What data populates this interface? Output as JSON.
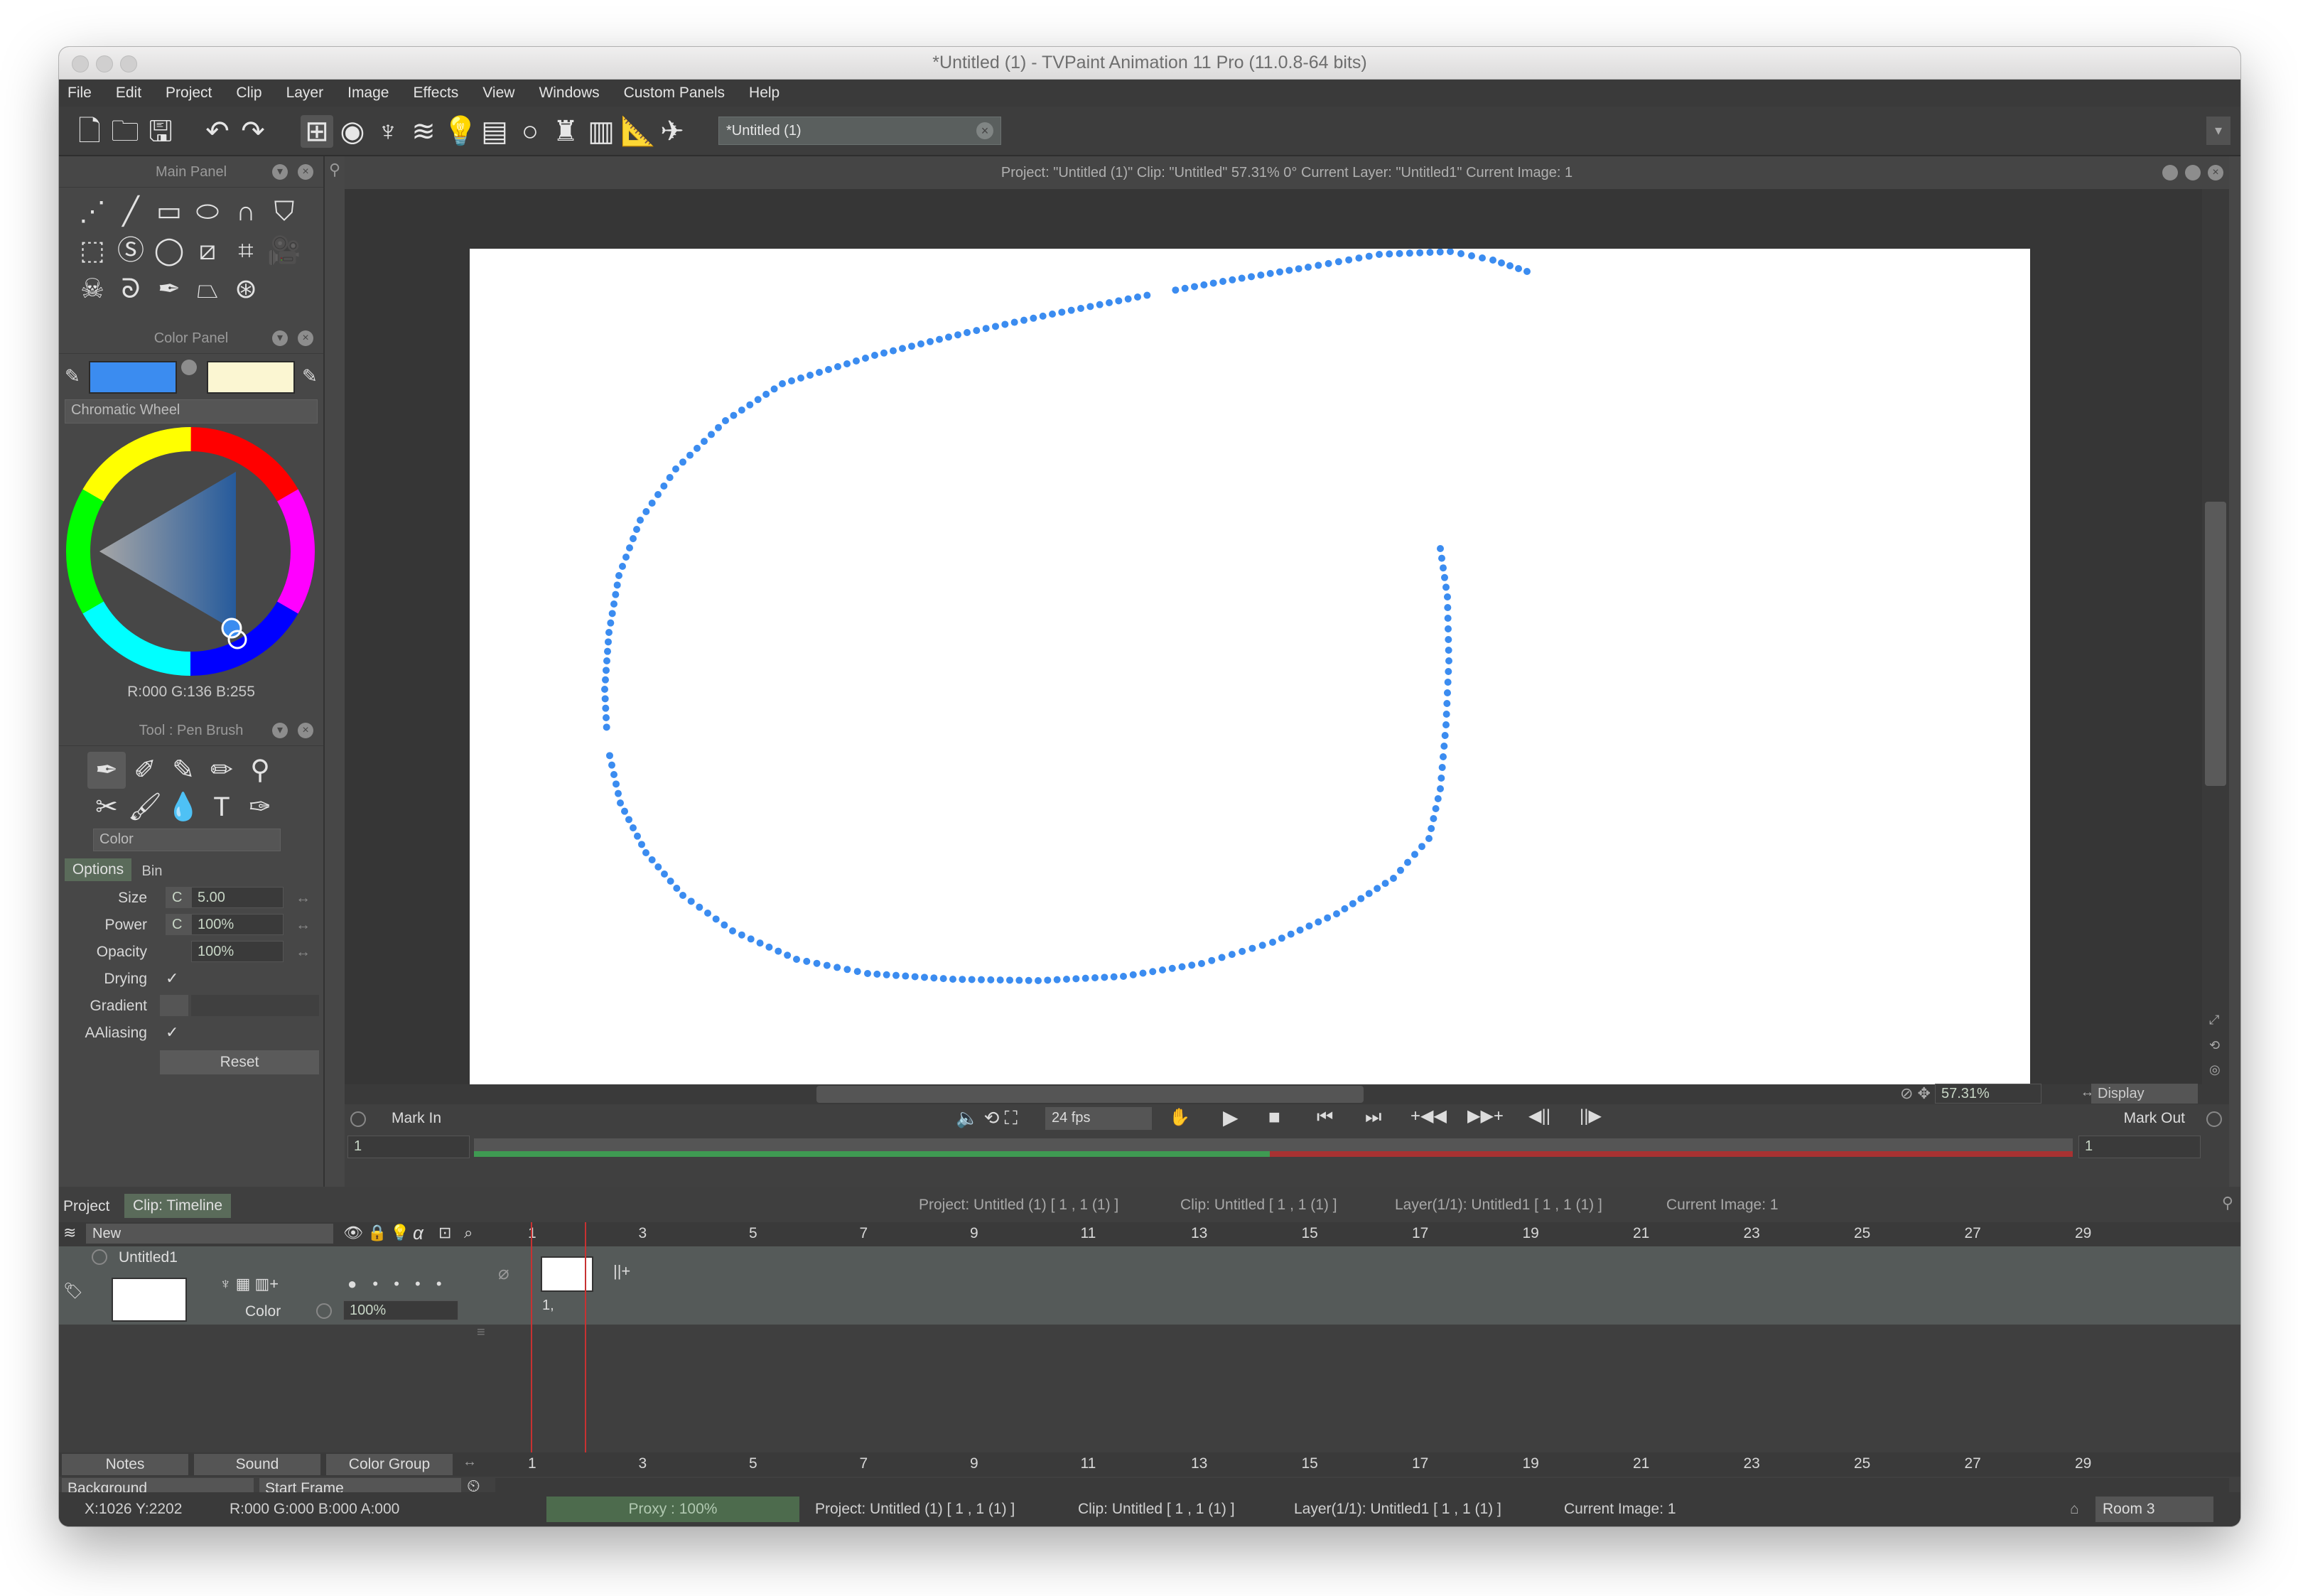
{
  "window": {
    "title": "*Untitled (1) - TVPaint Animation 11 Pro (11.0.8-64 bits)"
  },
  "menu": [
    "File",
    "Edit",
    "Project",
    "Clip",
    "Layer",
    "Image",
    "Effects",
    "View",
    "Windows",
    "Custom Panels",
    "Help"
  ],
  "document_tab": {
    "label": "*Untitled (1)"
  },
  "main_panel": {
    "title": "Main Panel"
  },
  "color_panel": {
    "title": "Color Panel",
    "primary_color": "#3b8cf0",
    "secondary_color": "#fbf6d2",
    "mode": "Chromatic Wheel",
    "readout": "R:000 G:136 B:255"
  },
  "tool_panel": {
    "title": "Tool : Pen Brush",
    "color_mode": "Color",
    "tabs": [
      "Options",
      "Bin"
    ],
    "options": [
      {
        "label": "Size",
        "value": "5.00"
      },
      {
        "label": "Power",
        "value": "100%"
      },
      {
        "label": "Opacity",
        "value": "100%"
      }
    ],
    "drying_label": "Drying",
    "gradient_label": "Gradient",
    "aaliasing_label": "AAliasing",
    "reset_label": "Reset"
  },
  "canvas": {
    "info": "Project: \"Untitled (1)\"  Clip: \"Untitled\"  57.31%  0°  Current Layer: \"Untitled1\"  Current Image: 1",
    "zoom": "57.31%",
    "display_label": "Display",
    "stroke_color": "#3b8cf0"
  },
  "playback": {
    "mark_in": "Mark In",
    "mark_out": "Mark Out",
    "fps": "24 fps",
    "in_value": "1",
    "out_value": "1"
  },
  "timeline": {
    "tabs": [
      "Project",
      "Clip: Timeline"
    ],
    "summary": [
      "Project: Untitled (1) [ 1 , 1  (1) ]",
      "Clip: Untitled [ 1 , 1  (1) ]",
      "Layer(1/1): Untitled1 [ 1 , 1  (1) ]",
      "Current Image: 1"
    ],
    "new_label": "New",
    "layer_name": "Untitled1",
    "layer_mode": "Color",
    "layer_opacity": "100%",
    "frame_numbers": [
      "1",
      "3",
      "5",
      "7",
      "9",
      "11",
      "13",
      "15",
      "17",
      "19",
      "21",
      "23",
      "25",
      "27",
      "29"
    ],
    "cell_label": "1,",
    "bottom_tabs": [
      "Notes",
      "Sound",
      "Color Group"
    ],
    "background_label": "Background",
    "start_frame_label": "Start Frame"
  },
  "status": {
    "coords": "X:1026  Y:2202",
    "rgba": "R:000 G:000 B:000 A:000",
    "proxy": "Proxy : 100%",
    "project": "Project: Untitled (1) [ 1 , 1  (1) ]",
    "clip": "Clip: Untitled [ 1 , 1  (1) ]",
    "layer": "Layer(1/1): Untitled1 [ 1 , 1  (1) ]",
    "current_image": "Current Image: 1",
    "room": "Room 3"
  }
}
